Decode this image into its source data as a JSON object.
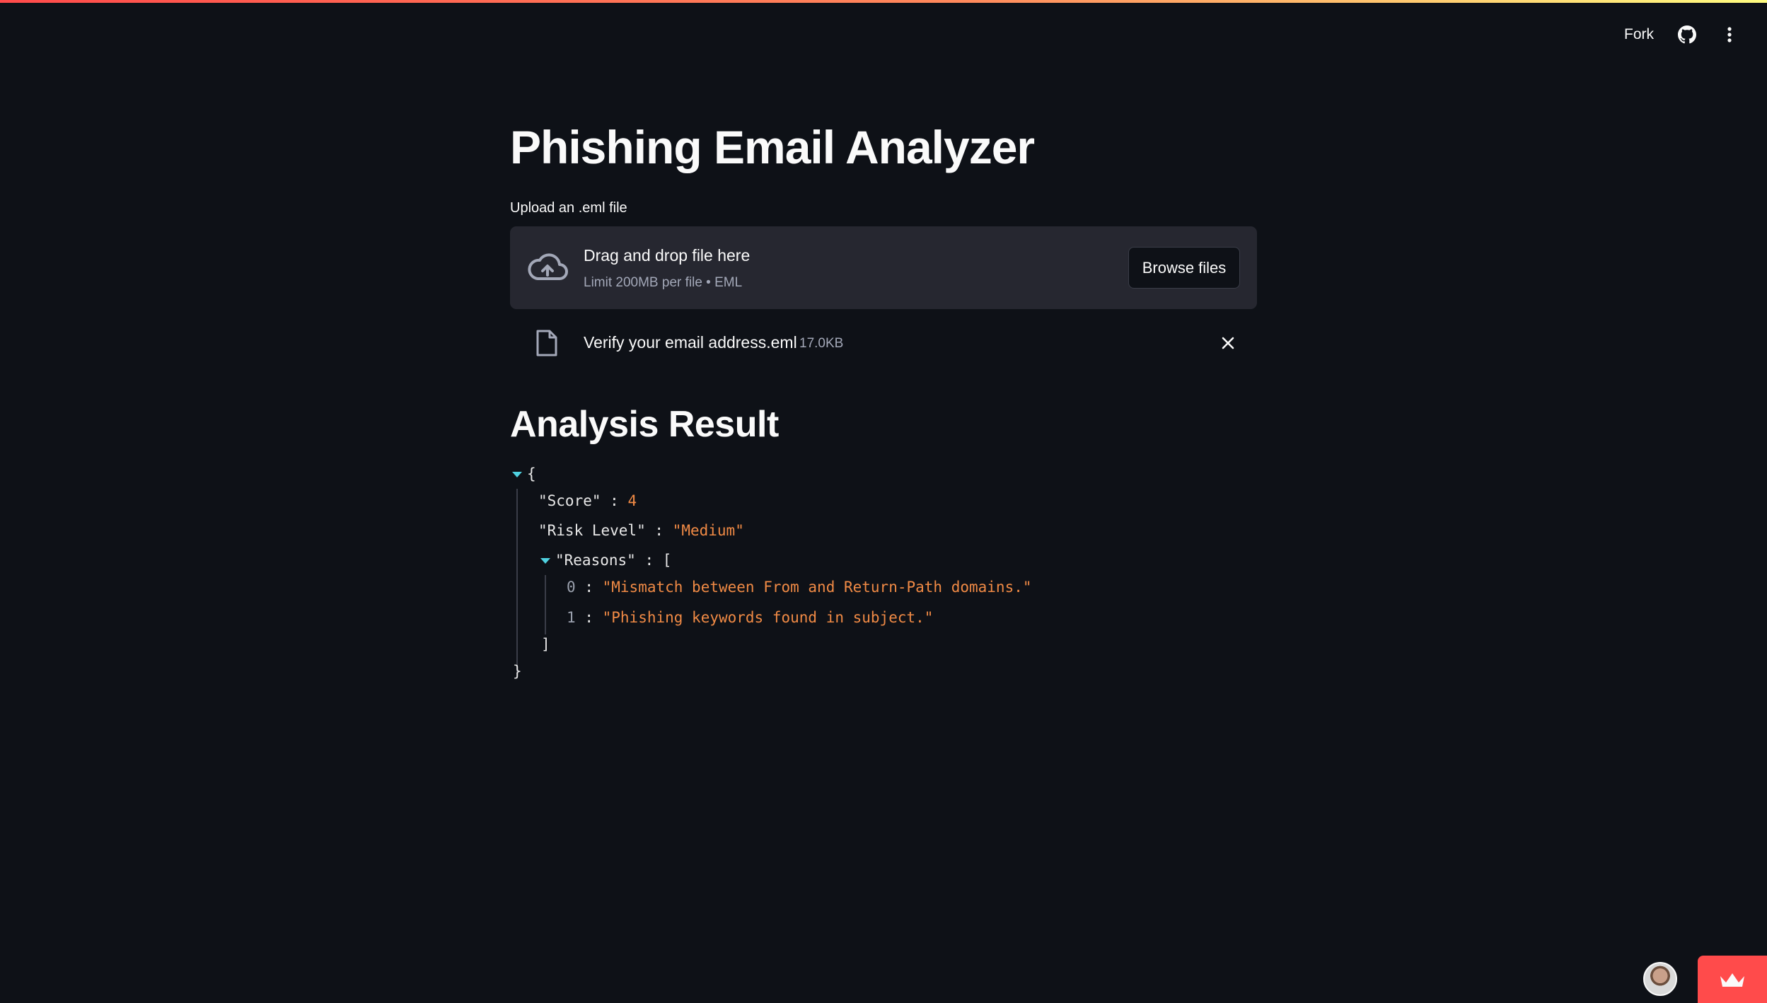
{
  "header": {
    "fork_label": "Fork",
    "github_icon": "github-icon",
    "menu_icon": "kebab-menu-icon"
  },
  "page": {
    "title": "Phishing Email Analyzer"
  },
  "uploader": {
    "label": "Upload an .eml file",
    "drop_title": "Drag and drop file here",
    "drop_sub": "Limit 200MB per file • EML",
    "browse_label": "Browse files",
    "icon": "cloud-upload-icon"
  },
  "uploaded_file": {
    "name": "Verify your email address.eml",
    "size": "17.0KB",
    "icon": "file-icon",
    "remove_icon": "close-icon"
  },
  "result": {
    "heading": "Analysis Result",
    "open_brace": "{",
    "close_brace": "}",
    "score_key": "\"Score\"",
    "score_value": "4",
    "risk_key": "\"Risk Level\"",
    "risk_value": "\"Medium\"",
    "reasons_key": "\"Reasons\"",
    "open_bracket": "[",
    "close_bracket": "]",
    "colon": ":",
    "reasons": [
      {
        "index": "0",
        "value": "\"Mismatch between From and Return-Path domains.\""
      },
      {
        "index": "1",
        "value": "\"Phishing keywords found in subject.\""
      }
    ]
  },
  "colors": {
    "background": "#0e1117",
    "surface": "#262730",
    "accent": "#ff4b4b",
    "json_value": "#f08a45",
    "json_toggle": "#4fd1e0"
  }
}
